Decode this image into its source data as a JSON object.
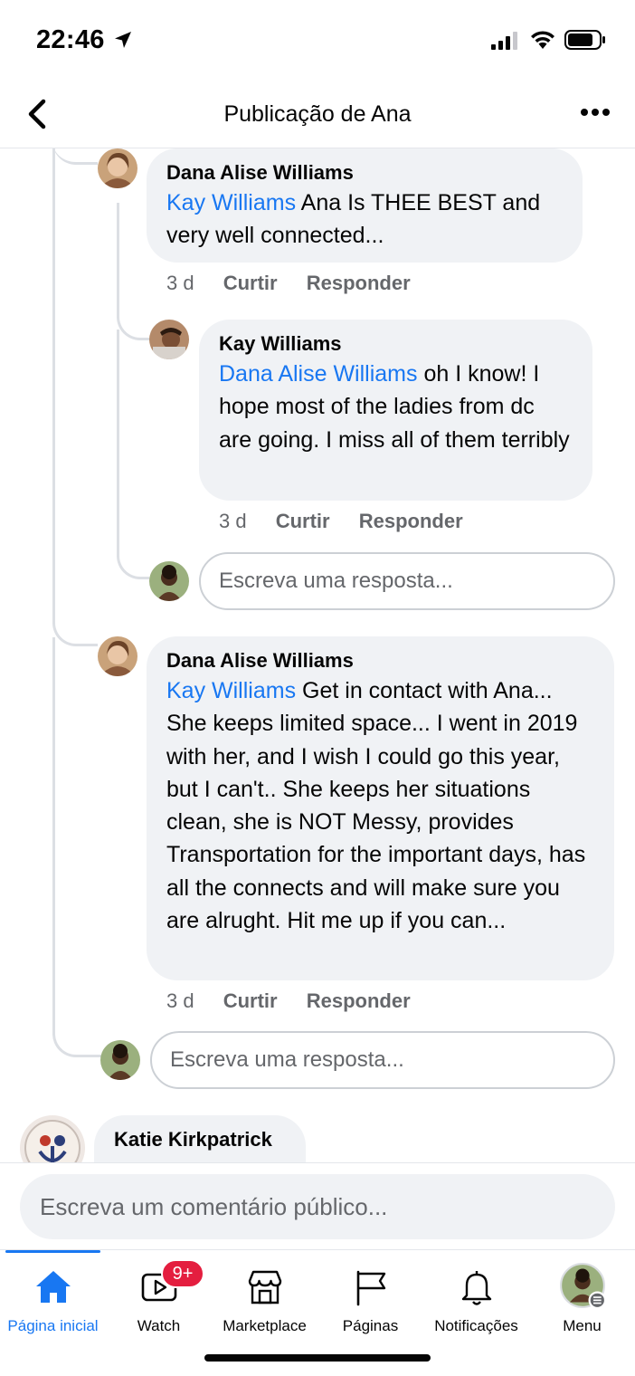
{
  "status_bar": {
    "time": "22:46"
  },
  "header": {
    "title": "Publicação de Ana"
  },
  "comments": [
    {
      "author": "Dana Alise Williams",
      "mention": "Kay Williams",
      "text": " Ana Is THEE BEST and very well connected...",
      "time": "3 d",
      "like": "Curtir",
      "reply": "Responder"
    },
    {
      "author": "Kay Williams",
      "mention": "Dana Alise Williams",
      "text": " oh I know! I hope most of the ladies from dc are going. I miss all of them terribly",
      "time": "3 d",
      "like": "Curtir",
      "reply": "Responder"
    },
    {
      "author": "Dana Alise Williams",
      "mention": "Kay Williams",
      "text": " Get in contact with Ana... She keeps limited space... I went in 2019 with her, and I wish I could go this year, but I can't.. She keeps her situations clean, she is NOT Messy, provides Transportation for the important days, has all the connects and will make sure you are alrught. Hit me up if you can...",
      "time": "3 d",
      "like": "Curtir",
      "reply": "Responder"
    },
    {
      "author": "Katie Kirkpatrick"
    }
  ],
  "reply_placeholder": "Escreva uma resposta...",
  "composer": {
    "placeholder": "Escreva um comentário público..."
  },
  "tabs": [
    {
      "label": "Página inicial",
      "icon": "home-icon"
    },
    {
      "label": "Watch",
      "icon": "watch-icon"
    },
    {
      "label": "Marketplace",
      "icon": "marketplace-icon"
    },
    {
      "label": "Páginas",
      "icon": "flag-icon"
    },
    {
      "label": "Notificações",
      "icon": "bell-icon"
    },
    {
      "label": "Menu",
      "icon": "profile-avatar"
    }
  ],
  "watch_badge": "9+",
  "colors": {
    "accent": "#1877f2",
    "bubble": "#f0f2f5",
    "badge": "#e41e3f",
    "secondary_text": "#65676b"
  }
}
